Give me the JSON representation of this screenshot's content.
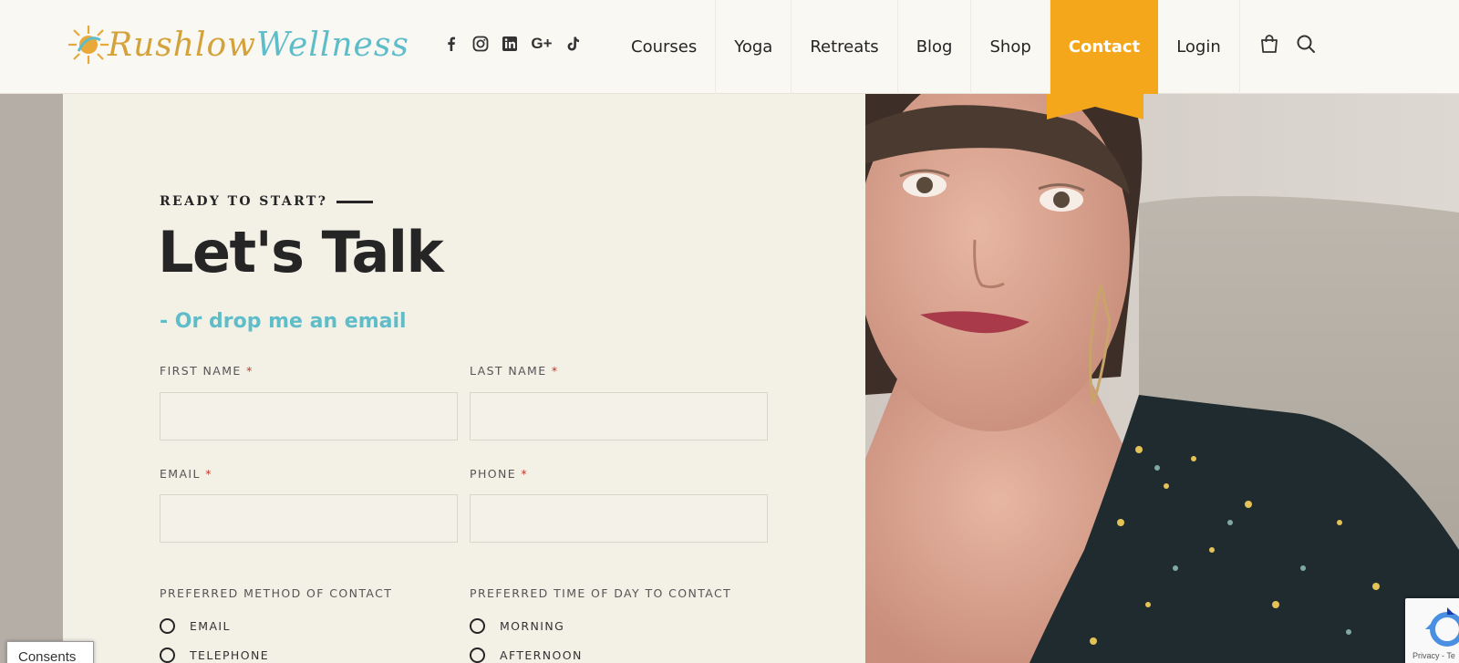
{
  "header": {
    "logo": {
      "text_part1": "Rushlow",
      "text_part2": "Wellness"
    },
    "socials": [
      {
        "name": "facebook-icon"
      },
      {
        "name": "instagram-icon"
      },
      {
        "name": "linkedin-icon"
      },
      {
        "name": "google-plus-icon",
        "label": "G+"
      },
      {
        "name": "tiktok-icon"
      }
    ],
    "nav": [
      {
        "label": "Courses"
      },
      {
        "label": "Yoga"
      },
      {
        "label": "Retreats"
      },
      {
        "label": "Blog"
      },
      {
        "label": "Shop"
      },
      {
        "label": "Contact",
        "active": true
      },
      {
        "label": "Login"
      }
    ],
    "accent_color": "#f5a71c"
  },
  "contact": {
    "eyebrow": "READY TO START?",
    "title": "Let's Talk",
    "email_link": "- Or drop me an email",
    "fields": {
      "first_name": {
        "label": "FIRST NAME",
        "required": "*",
        "value": ""
      },
      "last_name": {
        "label": "LAST NAME",
        "required": "*",
        "value": ""
      },
      "email": {
        "label": "EMAIL",
        "required": "*",
        "value": ""
      },
      "phone": {
        "label": "PHONE",
        "required": "*",
        "value": ""
      }
    },
    "preferred_method": {
      "label": "PREFERRED METHOD OF CONTACT",
      "options": [
        "EMAIL",
        "TELEPHONE"
      ]
    },
    "preferred_time": {
      "label": "PREFERRED TIME OF DAY TO CONTACT",
      "options": [
        "MORNING",
        "AFTERNOON"
      ]
    },
    "link_color": "#5fbdc9"
  },
  "consents_button": "Consents",
  "recaptcha_text": "Privacy - Te"
}
